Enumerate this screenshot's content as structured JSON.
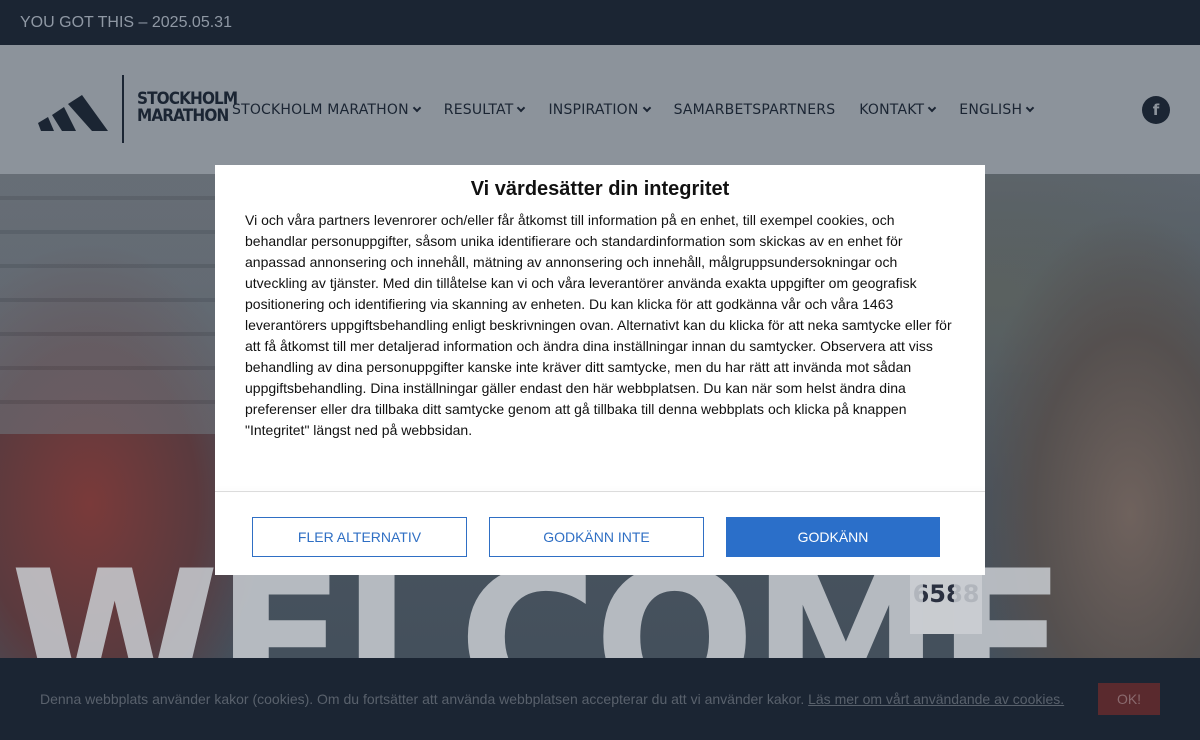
{
  "topbar": {
    "text": "YOU GOT THIS – 2025.05.31"
  },
  "logo": {
    "line1": "STOCKHOLM",
    "line2": "MARATHON"
  },
  "nav": {
    "items": [
      {
        "label": "STOCKHOLM MARATHON",
        "dropdown": true
      },
      {
        "label": "RESULTAT",
        "dropdown": true
      },
      {
        "label": "INSPIRATION",
        "dropdown": true
      },
      {
        "label": "SAMARBETSPARTNERS",
        "dropdown": false
      },
      {
        "label": "KONTAKT",
        "dropdown": true
      },
      {
        "label": "ENGLISH",
        "dropdown": true
      }
    ]
  },
  "social": {
    "facebook_glyph": "f"
  },
  "hero": {
    "welcome": "WELCOME",
    "bib_number": "6588"
  },
  "consent": {
    "title": "Vi värdesätter din integritet",
    "body": "Vi och våra partners levenrorer och/eller får åtkomst till information på en enhet, till exempel cookies, och behandlar personuppgifter, såsom unika identifierare och standardinformation som skickas av en enhet för anpassad annonsering och innehåll, mätning av annonsering och innehåll, målgruppsundersokningar och utveckling av tjänster. Med din tillåtelse kan vi och våra leverantörer använda exakta uppgifter om geografisk positionering och identifiering via skanning av enheten. Du kan klicka för att godkänna vår och våra 1463 leverantörers uppgiftsbehandling enligt beskrivningen ovan. Alternativt kan du klicka för att neka samtycke eller för att få åtkomst till mer detaljerad information och ändra dina inställningar innan du samtycker. Observera att viss behandling av dina personuppgifter kanske inte kräver ditt samtycke, men du har rätt att invända mot sådan uppgiftsbehandling. Dina inställningar gäller endast den här webbplatsen. Du kan när som helst ändra dina preferenser eller dra tillbaka ditt samtycke genom att gå tillbaka till denna webbplats och klicka på knappen \"Integritet\" längst ned på webbsidan.",
    "buttons": {
      "more": "FLER ALTERNATIV",
      "reject": "GODKÄNN INTE",
      "accept": "GODKÄNN"
    }
  },
  "cookie_bar": {
    "text": "Denna webbplats använder kakor (cookies). Om du fortsätter att använda webbplatsen accepterar du att vi använder kakor.",
    "link": "Läs mer om vårt användande av cookies.",
    "ok": "OK!"
  },
  "colors": {
    "navy": "#1b2533",
    "accept_blue": "#2b6fc9",
    "outline_blue": "#2f6fc4",
    "ok_red": "#5a2a2e"
  }
}
